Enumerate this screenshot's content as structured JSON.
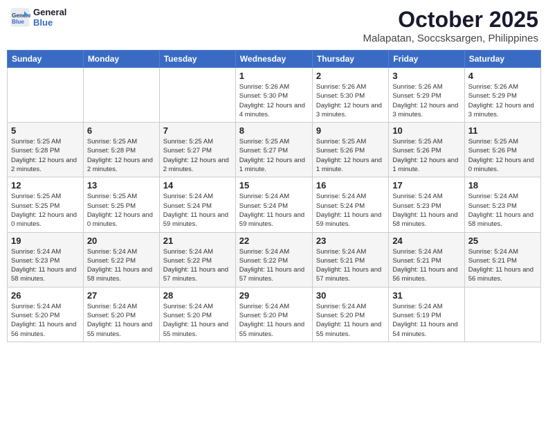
{
  "logo": {
    "line1": "General",
    "line2": "Blue"
  },
  "title": "October 2025",
  "location": "Malapatan, Soccsksargen, Philippines",
  "weekdays": [
    "Sunday",
    "Monday",
    "Tuesday",
    "Wednesday",
    "Thursday",
    "Friday",
    "Saturday"
  ],
  "weeks": [
    [
      null,
      null,
      null,
      {
        "day": 1,
        "sunrise": "5:26 AM",
        "sunset": "5:30 PM",
        "daylight": "12 hours and 4 minutes."
      },
      {
        "day": 2,
        "sunrise": "5:26 AM",
        "sunset": "5:30 PM",
        "daylight": "12 hours and 3 minutes."
      },
      {
        "day": 3,
        "sunrise": "5:26 AM",
        "sunset": "5:29 PM",
        "daylight": "12 hours and 3 minutes."
      },
      {
        "day": 4,
        "sunrise": "5:26 AM",
        "sunset": "5:29 PM",
        "daylight": "12 hours and 3 minutes."
      }
    ],
    [
      {
        "day": 5,
        "sunrise": "5:25 AM",
        "sunset": "5:28 PM",
        "daylight": "12 hours and 2 minutes."
      },
      {
        "day": 6,
        "sunrise": "5:25 AM",
        "sunset": "5:28 PM",
        "daylight": "12 hours and 2 minutes."
      },
      {
        "day": 7,
        "sunrise": "5:25 AM",
        "sunset": "5:27 PM",
        "daylight": "12 hours and 2 minutes."
      },
      {
        "day": 8,
        "sunrise": "5:25 AM",
        "sunset": "5:27 PM",
        "daylight": "12 hours and 1 minute."
      },
      {
        "day": 9,
        "sunrise": "5:25 AM",
        "sunset": "5:26 PM",
        "daylight": "12 hours and 1 minute."
      },
      {
        "day": 10,
        "sunrise": "5:25 AM",
        "sunset": "5:26 PM",
        "daylight": "12 hours and 1 minute."
      },
      {
        "day": 11,
        "sunrise": "5:25 AM",
        "sunset": "5:26 PM",
        "daylight": "12 hours and 0 minutes."
      }
    ],
    [
      {
        "day": 12,
        "sunrise": "5:25 AM",
        "sunset": "5:25 PM",
        "daylight": "12 hours and 0 minutes."
      },
      {
        "day": 13,
        "sunrise": "5:25 AM",
        "sunset": "5:25 PM",
        "daylight": "12 hours and 0 minutes."
      },
      {
        "day": 14,
        "sunrise": "5:24 AM",
        "sunset": "5:24 PM",
        "daylight": "11 hours and 59 minutes."
      },
      {
        "day": 15,
        "sunrise": "5:24 AM",
        "sunset": "5:24 PM",
        "daylight": "11 hours and 59 minutes."
      },
      {
        "day": 16,
        "sunrise": "5:24 AM",
        "sunset": "5:24 PM",
        "daylight": "11 hours and 59 minutes."
      },
      {
        "day": 17,
        "sunrise": "5:24 AM",
        "sunset": "5:23 PM",
        "daylight": "11 hours and 58 minutes."
      },
      {
        "day": 18,
        "sunrise": "5:24 AM",
        "sunset": "5:23 PM",
        "daylight": "11 hours and 58 minutes."
      }
    ],
    [
      {
        "day": 19,
        "sunrise": "5:24 AM",
        "sunset": "5:23 PM",
        "daylight": "11 hours and 58 minutes."
      },
      {
        "day": 20,
        "sunrise": "5:24 AM",
        "sunset": "5:22 PM",
        "daylight": "11 hours and 58 minutes."
      },
      {
        "day": 21,
        "sunrise": "5:24 AM",
        "sunset": "5:22 PM",
        "daylight": "11 hours and 57 minutes."
      },
      {
        "day": 22,
        "sunrise": "5:24 AM",
        "sunset": "5:22 PM",
        "daylight": "11 hours and 57 minutes."
      },
      {
        "day": 23,
        "sunrise": "5:24 AM",
        "sunset": "5:21 PM",
        "daylight": "11 hours and 57 minutes."
      },
      {
        "day": 24,
        "sunrise": "5:24 AM",
        "sunset": "5:21 PM",
        "daylight": "11 hours and 56 minutes."
      },
      {
        "day": 25,
        "sunrise": "5:24 AM",
        "sunset": "5:21 PM",
        "daylight": "11 hours and 56 minutes."
      }
    ],
    [
      {
        "day": 26,
        "sunrise": "5:24 AM",
        "sunset": "5:20 PM",
        "daylight": "11 hours and 56 minutes."
      },
      {
        "day": 27,
        "sunrise": "5:24 AM",
        "sunset": "5:20 PM",
        "daylight": "11 hours and 55 minutes."
      },
      {
        "day": 28,
        "sunrise": "5:24 AM",
        "sunset": "5:20 PM",
        "daylight": "11 hours and 55 minutes."
      },
      {
        "day": 29,
        "sunrise": "5:24 AM",
        "sunset": "5:20 PM",
        "daylight": "11 hours and 55 minutes."
      },
      {
        "day": 30,
        "sunrise": "5:24 AM",
        "sunset": "5:20 PM",
        "daylight": "11 hours and 55 minutes."
      },
      {
        "day": 31,
        "sunrise": "5:24 AM",
        "sunset": "5:19 PM",
        "daylight": "11 hours and 54 minutes."
      },
      null
    ]
  ]
}
